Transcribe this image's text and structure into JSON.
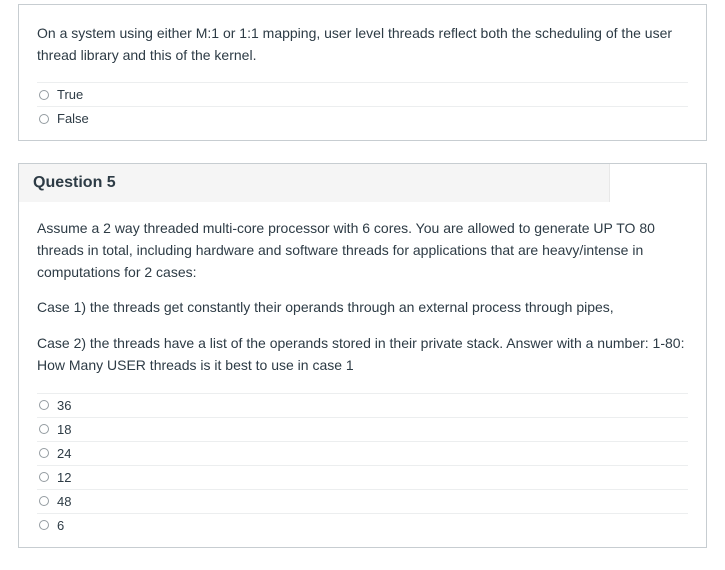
{
  "question4": {
    "text": "On a system using either M:1 or 1:1 mapping, user level threads reflect both the scheduling of the user thread library and this of the kernel.",
    "options": [
      "True",
      "False"
    ]
  },
  "question5": {
    "title": "Question 5",
    "p1": "Assume a 2 way threaded multi-core processor with 6 cores. You are allowed to generate UP TO 80 threads in total, including hardware and software threads for applications that are heavy/intense in computations for 2 cases:",
    "p2": "Case 1) the threads get constantly their operands through an external process through pipes,",
    "p3": "Case 2) the threads have a list of the operands stored in their private stack. Answer with a number: 1-80: How Many USER threads is it best to use in case 1",
    "options": [
      "36",
      "18",
      "24",
      "12",
      "48",
      "6"
    ]
  }
}
